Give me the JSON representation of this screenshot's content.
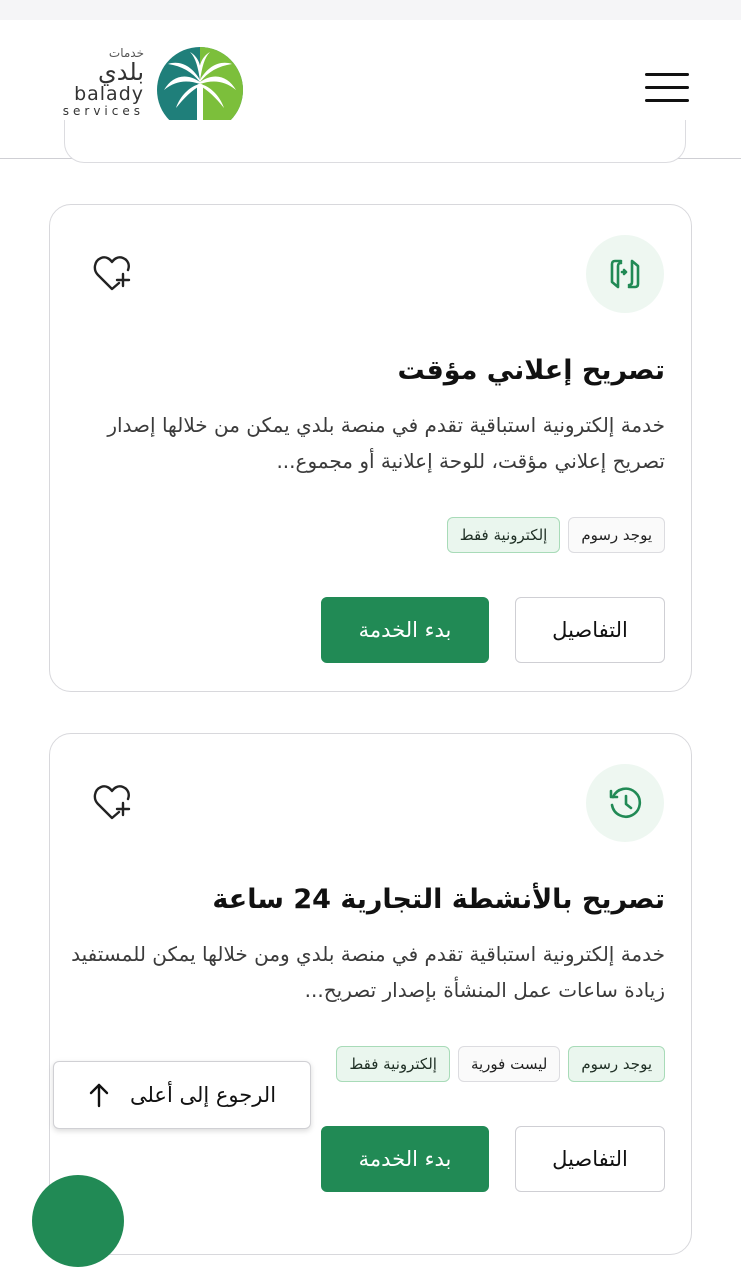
{
  "header": {
    "logo": {
      "ar_small": "خدمات",
      "ar_big": "بلدي",
      "en": "balady",
      "en_small": "services"
    },
    "menu_icon": "hamburger-icon"
  },
  "cards": [
    {
      "title": "تصريح إعلاني مؤقت",
      "description": "خدمة إلكترونية استباقية تقدم في منصة بلدي يمكن من خلالها إصدار تصريح إعلاني مؤقت، للوحة إعلانية أو مجموع...",
      "tags": [
        "إلكترونية فقط",
        "يوجد رسوم"
      ],
      "details_label": "التفاصيل",
      "start_label": "بدء الخدمة",
      "icon": "document-transfer-icon"
    },
    {
      "title": "تصريح بالأنشطة التجارية 24 ساعة",
      "description": "خدمة إلكترونية استباقية تقدم في منصة بلدي ومن خلالها يمكن للمستفيد زيادة ساعات عمل المنشأة بإصدار تصريح...",
      "tags": [
        "إلكترونية فقط",
        "ليست فورية",
        "يوجد رسوم"
      ],
      "details_label": "التفاصيل",
      "start_label": "بدء الخدمة",
      "icon": "clock-history-icon"
    }
  ],
  "back_to_top": {
    "label": "الرجوع إلى أعلى",
    "icon": "arrow-up-icon"
  },
  "colors": {
    "primary": "#218a55",
    "tag_green_bg": "#eaf6ee"
  }
}
